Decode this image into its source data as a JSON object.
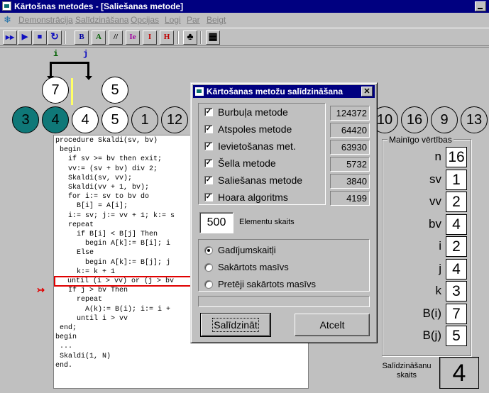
{
  "window": {
    "title": "Kārtošnas metodes - [Saliešanas metode]"
  },
  "menu": [
    "Demonstrācija",
    "Salīdzināšana",
    "Opcijas",
    "Logi",
    "Par",
    "Beigt"
  ],
  "toolbar": {
    "buttons": [
      {
        "icon": "step-forward-icon",
        "glyph": "▶▶"
      },
      {
        "icon": "play-icon",
        "glyph": "▶"
      },
      {
        "icon": "stop-icon",
        "glyph": "■"
      },
      {
        "icon": "refresh-icon",
        "glyph": "↻"
      },
      {
        "icon": "bubble-sort-icon",
        "glyph": "B"
      },
      {
        "icon": "insertion-sort-icon",
        "glyph": "A"
      },
      {
        "icon": "shell-sort-icon",
        "glyph": "//"
      },
      {
        "icon": "merge-sort-icon",
        "glyph": "Ie"
      },
      {
        "icon": "insert-sort-icon",
        "glyph": "I"
      },
      {
        "icon": "quick-sort-icon",
        "glyph": "H"
      },
      {
        "icon": "person-icon",
        "glyph": "♣"
      },
      {
        "icon": "calculator-icon",
        "glyph": "▦"
      }
    ]
  },
  "pointers": {
    "i": "i",
    "j": "j"
  },
  "temp_circles": [
    "7",
    "5"
  ],
  "array_circles": [
    "3",
    "4",
    "4",
    "5",
    "1",
    "12",
    "10",
    "16",
    "9",
    "13"
  ],
  "code_lines": [
    "procedure Skaldi(sv, bv)",
    " begin",
    "   if sv >= bv then exit;",
    "   vv:= (sv + bv) div 2;",
    "   Skaldi(sv, vv);",
    "   Skaldi(vv + 1, bv);",
    "   for i:= sv to bv do",
    "     B[i] = A[i];",
    "   i:= sv; j:= vv + 1; k:= s",
    "   repeat",
    "     if B[i] < B[j] Then",
    "       begin A[k]:= B[i]; i",
    "     Else",
    "       begin A[k]:= B[j]; j",
    "     k:= k + 1",
    "   until (i > vv) or (j > bv",
    "   If j > bv Then",
    "     repeat",
    "       A(k):= B(i); i:= i +",
    "     until i > vv",
    " end;",
    "begin",
    " ...",
    " Skaldi(1, N)",
    "end."
  ],
  "highlighted_line": 15,
  "variables": {
    "title": "Mainīgo vērtības",
    "items": [
      {
        "name": "n",
        "value": "16"
      },
      {
        "name": "sv",
        "value": "1"
      },
      {
        "name": "vv",
        "value": "2"
      },
      {
        "name": "bv",
        "value": "4"
      },
      {
        "name": "i",
        "value": "2"
      },
      {
        "name": "j",
        "value": "4"
      },
      {
        "name": "k",
        "value": "3"
      },
      {
        "name": "B(i)",
        "value": "7"
      },
      {
        "name": "B(j)",
        "value": "5"
      }
    ]
  },
  "comparisons": {
    "label": "Salīdzināšanu skaits",
    "value": "4"
  },
  "dialog": {
    "title": "Kārtošanas metožu salīdzināšana",
    "close": "✕",
    "methods": [
      {
        "label": "Burbuļa metode",
        "result": "124372",
        "checked": true
      },
      {
        "label": "Atspoles metode",
        "result": "64420",
        "checked": true
      },
      {
        "label": "Ievietošanas met.",
        "result": "63930",
        "checked": true
      },
      {
        "label": "Šella metode",
        "result": "5732",
        "checked": true
      },
      {
        "label": "Saliešanas metode",
        "result": "3840",
        "checked": true
      },
      {
        "label": "Hoara algoritms",
        "result": "4199",
        "checked": true
      }
    ],
    "count_value": "500",
    "count_label": "Elementu skaits",
    "options": [
      {
        "label": "Gadījumskaitļi",
        "selected": true
      },
      {
        "label": "Sakārtots masīvs",
        "selected": false
      },
      {
        "label": "Pretēji sakārtots masīvs",
        "selected": false
      }
    ],
    "compare_button": "Salīdzināt",
    "cancel_button": "Atcelt"
  }
}
